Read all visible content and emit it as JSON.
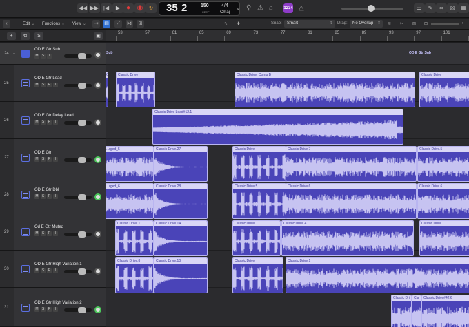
{
  "control_bar": {
    "lcd": {
      "bar": "35",
      "beat": "2",
      "tempo": "150",
      "tempo_label": "KEEP",
      "time_sig": "4/4",
      "key": "Cmaj"
    },
    "count_in": "1234"
  },
  "menus": {
    "edit": "Edit",
    "functions": "Functions",
    "view": "View",
    "snap_label": "Snap:",
    "snap_value": "Smart",
    "drag_label": "Drag:",
    "drag_value": "No Overlap"
  },
  "header_buttons": {
    "add": "+",
    "solo": "S"
  },
  "ruler": [
    "53",
    "57",
    "61",
    "65",
    "69",
    "73",
    "77",
    "81",
    "85",
    "89",
    "93",
    "97",
    "101",
    "105"
  ],
  "tracks": [
    {
      "num": "24",
      "name": "OD E Gtr Sub",
      "type": "folder"
    },
    {
      "num": "25",
      "name": "OD E Gtr Lead"
    },
    {
      "num": "26",
      "name": "OD E Gtr Delay Lead"
    },
    {
      "num": "27",
      "name": "OD E Gtr"
    },
    {
      "num": "28",
      "name": "OD E Gtr Dbl"
    },
    {
      "num": "29",
      "name": "Od E Gtr Muted"
    },
    {
      "num": "30",
      "name": "OD E Gtr High Variation 1"
    },
    {
      "num": "31",
      "name": "OD E Gtr High Variation 2"
    }
  ],
  "msr_labels": {
    "m": "M",
    "s": "S",
    "r": "R",
    "i": "I"
  },
  "folder_labels": {
    "left": "Sub",
    "right": "OD E Gtr Sub"
  },
  "regions": {
    "t25_a": "Classic Drive",
    "t25_b": "Classic Drive: Comp B",
    "t25_c": "Classic Drive",
    "t26_a": "Classic Drive Lead#12.1",
    "t27_a": "...rged_5",
    "t27_b": "Classic Drive.27",
    "t27_c": "Classic Drive",
    "t27_d": "Classic Drive.7",
    "t27_e": "Classic Drive.5",
    "t28_a": "...rged_6",
    "t28_b": "Classic Drive.28",
    "t28_c": "Classic Drive.5",
    "t28_d": "Classic Drive.6",
    "t28_e": "Classic Drive.6",
    "t29_a": "Classic Drive.11",
    "t29_b": "Classic Drive.14",
    "t29_c": "Classic Drive",
    "t29_d": "Classic Drive.4",
    "t29_e": "Classic Drive",
    "t30_a": "Classic Drive.8",
    "t30_b": "Classic Drive.10",
    "t30_c": "Classic Drive",
    "t30_d": "Classic Drive.1",
    "t31_a": "Classic Dri",
    "t31_b": "Cla",
    "t31_c": "Classic Drive#42.6"
  },
  "colors": {
    "region_fill": "#4a44b8",
    "region_header": "#d9d6f6",
    "accent_blue": "#2f6fd1",
    "record": "#e23b3b",
    "count_in": "#8e3cc9"
  }
}
